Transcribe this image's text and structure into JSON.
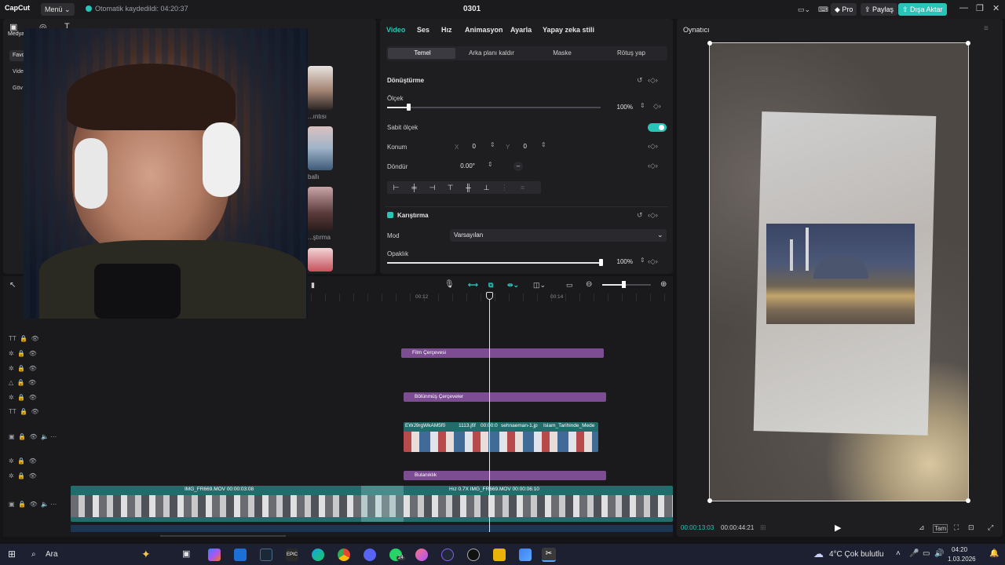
{
  "titlebar": {
    "app_name": "CapCut",
    "menu_label": "Menü",
    "autosave": "Otomatik kaydedildi: 04:20:37",
    "project_title": "0301",
    "pro_label": "Pro",
    "share_label": "Paylaş",
    "export_label": "Dışa Aktar"
  },
  "left_panel": {
    "media_label": "Medya",
    "nav": [
      "Favo",
      "Vide",
      "Göv"
    ],
    "captions": [
      "...ıntısı",
      "ballı",
      "...ştırma"
    ]
  },
  "inspector": {
    "tabs": [
      "Video",
      "Ses",
      "Hız",
      "Animasyon",
      "Ayarla",
      "Yapay zeka stili"
    ],
    "subtabs": [
      "Temel",
      "Arka planı kaldır",
      "Maske",
      "Rötuş yap"
    ],
    "transform_title": "Dönüştürme",
    "scale_label": "Ölçek",
    "scale_value": "100%",
    "scale_level": 0.1,
    "uniform_scale_label": "Sabit ölçek",
    "position_label": "Konum",
    "pos_x_label": "X",
    "pos_x_value": "0",
    "pos_y_label": "Y",
    "pos_y_value": "0",
    "rotate_label": "Döndür",
    "rotate_value": "0.00°",
    "blend_title": "Karıştırma",
    "mode_label": "Mod",
    "mode_value": "Varsayılan",
    "opacity_label": "Opaklık",
    "opacity_value": "100%",
    "opacity_level": 1.0
  },
  "player": {
    "title": "Oynatıcı",
    "current_time": "00:00:13:03",
    "total_time": "00:00:44:21",
    "ratio_label": "Tam"
  },
  "timeline": {
    "ruler_marks": [
      "00:12",
      "00:14"
    ],
    "clips": {
      "film_frame": "Film Çerçevesi",
      "broken_frames": "Bölünmüş Çerçeveler",
      "blur": "Bulanıklık",
      "overlay_labels": [
        "EWJ9rgWkAM5f0",
        "1113.jfif",
        "00:00:0",
        "sehnaeman-1.jp",
        "Islam_Tarihinde_Mede"
      ],
      "main_label_a": "IMG_FR669.MOV  00:00:03:08",
      "main_label_b": "Hız 0.7X  IMG_FR669.MOV  00:00:06:10"
    }
  },
  "taskbar": {
    "search_label": "Ara",
    "weather": "4°C  Çok bulutlu",
    "time": "04:20",
    "date": "1.03.2026",
    "whatsapp_badge": "24"
  },
  "colors": {
    "accent": "#29c4b8",
    "clip_purple": "#7d4d93",
    "clip_teal": "#1f6e6c"
  }
}
